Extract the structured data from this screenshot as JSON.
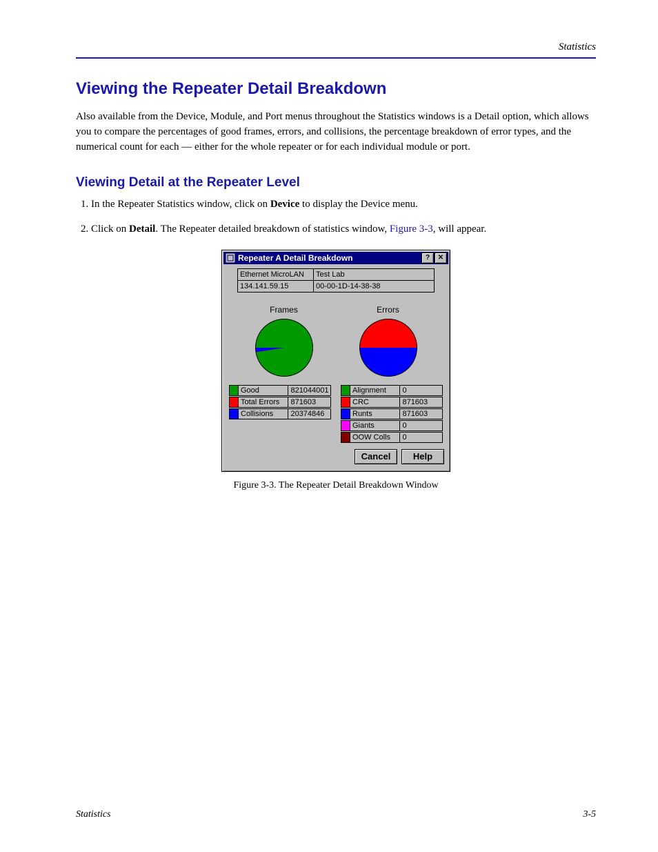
{
  "running_head": "Statistics",
  "heading": "Viewing the Repeater Detail Breakdown",
  "intro_para": "Also available from the Device, Module, and Port menus throughout the Statistics windows is a Detail option, which allows you to compare the percentages of good frames, errors, and collisions, the percentage breakdown of error types, and the numerical count for each — either for the whole repeater or for each individual module or port.",
  "sub_head": "Viewing Detail at the Repeater Level",
  "steps": [
    "In the Repeater Statistics window, click on Device to display the Device menu.",
    "Click on Detail. The Repeater detailed breakdown of statistics window, Figure 3-3, will appear."
  ],
  "result_line_pre": "The Repeater detailed breakdown of statistics window, ",
  "result_link": "Figure 3-3",
  "result_line_post": ", will appear.",
  "dialog": {
    "title": "Repeater A Detail Breakdown",
    "help_glyph": "?",
    "close_glyph": "✕",
    "info_table": {
      "r1c1": "Ethernet MicroLAN",
      "r1c2": "Test Lab",
      "r2c1": "134.141.59.15",
      "r2c2": "00-00-1D-14-38-38"
    },
    "frames_label": "Frames",
    "errors_label": "Errors",
    "cancel_label": "Cancel",
    "help_label": "Help"
  },
  "chart_data": [
    {
      "type": "pie",
      "title": "Frames",
      "series": [
        {
          "name": "Good",
          "value": 821044001,
          "color": "#009a00"
        },
        {
          "name": "Total Errors",
          "value": 871603,
          "color": "#ff0000"
        },
        {
          "name": "Collisions",
          "value": 20374846,
          "color": "#0000ff"
        }
      ]
    },
    {
      "type": "pie",
      "title": "Errors",
      "series": [
        {
          "name": "Alignment",
          "value": 0,
          "color": "#009a00"
        },
        {
          "name": "CRC",
          "value": 871603,
          "color": "#ff0000"
        },
        {
          "name": "Runts",
          "value": 871603,
          "color": "#0000ff"
        },
        {
          "name": "Giants",
          "value": 0,
          "color": "#ff00ff"
        },
        {
          "name": "OOW Colls",
          "value": 0,
          "color": "#800000"
        }
      ]
    }
  ],
  "figure_caption": {
    "num": "Figure 3-3.",
    "text": "The Repeater Detail Breakdown Window"
  },
  "footer": {
    "left": "Statistics",
    "right": "3-5"
  }
}
